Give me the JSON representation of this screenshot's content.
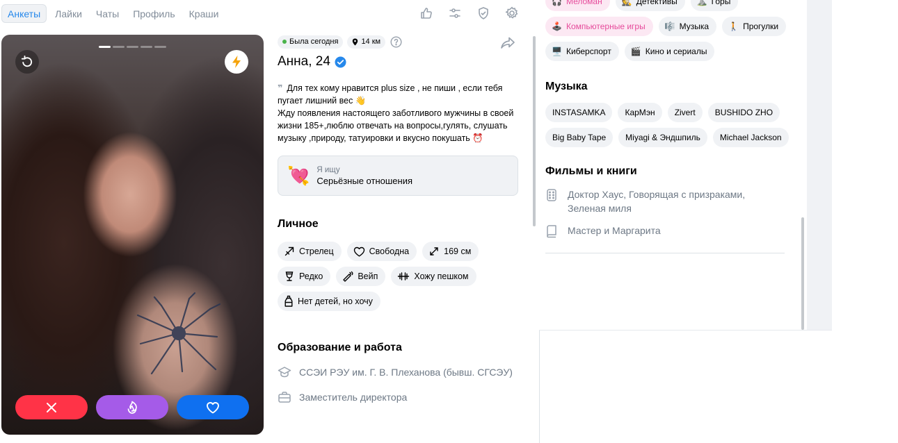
{
  "nav": {
    "tabs": [
      {
        "label": "Анкеты",
        "active": true
      },
      {
        "label": "Лайки",
        "active": false
      },
      {
        "label": "Чаты",
        "active": false
      },
      {
        "label": "Профиль",
        "active": false
      },
      {
        "label": "Краши",
        "active": false
      }
    ],
    "icons": [
      "thumbs-up-icon",
      "filter-sliders-icon",
      "shield-icon",
      "gear-icon"
    ]
  },
  "photo": {
    "page_count": 5,
    "current_page": 1
  },
  "profile": {
    "last_seen": "Была сегодня",
    "distance": "14 км",
    "name_age": "Анна, 24",
    "verified": true,
    "bio_line1": "Для тех кому нравится plus size , не пиши , если тебя пугает лишний вес 👋",
    "bio_line2": "Жду появления настоящего заботливого мужчины в своей жизни 185+,люблю отвечать на вопросы,гулять, слушать музыку ,природу, татуировки и вкусно покушать ⏰",
    "seek_label": "Я ищу",
    "seek_value": "Серьёзные отношения",
    "seek_icon": "💘"
  },
  "personal": {
    "title": "Личное",
    "chips": [
      {
        "icon": "sagittarius-icon",
        "label": "Стрелец"
      },
      {
        "icon": "heart-outline-icon",
        "label": "Свободна"
      },
      {
        "icon": "height-arrows-icon",
        "label": "169 см"
      },
      {
        "icon": "wine-glass-icon",
        "label": "Редко"
      },
      {
        "icon": "vape-icon",
        "label": "Вейп"
      },
      {
        "icon": "dumbbell-icon",
        "label": "Хожу пешком"
      },
      {
        "icon": "baby-bottle-icon",
        "label": "Нет детей, но хочу"
      }
    ]
  },
  "education": {
    "title": "Образование и работа",
    "items": [
      {
        "icon": "graduation-cap-icon",
        "text": "ССЭИ РЭУ им. Г. В. Плеханова (бывш. СГСЭУ)"
      },
      {
        "icon": "briefcase-icon",
        "text": "Заместитель директора"
      }
    ]
  },
  "interests": {
    "chips": [
      {
        "emoji": "🎧",
        "label": "Меломан",
        "highlight": true
      },
      {
        "emoji": "🕵️",
        "label": "Детективы",
        "highlight": false
      },
      {
        "emoji": "⛰️",
        "label": "Горы",
        "highlight": false
      },
      {
        "emoji": "🕹️",
        "label": "Компьютерные игры",
        "highlight": true
      },
      {
        "emoji": "🎼",
        "label": "Музыка",
        "highlight": false
      },
      {
        "emoji": "🚶",
        "label": "Прогулки",
        "highlight": false
      },
      {
        "emoji": "🖥️",
        "label": "Киберспорт",
        "highlight": false
      },
      {
        "emoji": "🎬",
        "label": "Кино и сериалы",
        "highlight": false
      }
    ]
  },
  "music": {
    "title": "Музыка",
    "chips": [
      "INSTASAMKA",
      "КарМэн",
      "Zivert",
      "BUSHIDO ZHO",
      "Big Baby Tape",
      "Miyagi & Эндшпиль",
      "Michael Jackson"
    ]
  },
  "books": {
    "title": "Фильмы и книги",
    "items": [
      {
        "icon": "film-icon",
        "text": "Доктор Хаус, Говорящая с призраками, Зеленая миля"
      },
      {
        "icon": "book-icon",
        "text": "Мастер и Маргарита"
      }
    ]
  },
  "colors": {
    "dislike": "#ff3347",
    "superlike": "#a55be8",
    "like": "#0f70f0",
    "accent": "#2688eb",
    "highlight_chip_text": "#e64b9b",
    "online": "#4bb34b"
  }
}
